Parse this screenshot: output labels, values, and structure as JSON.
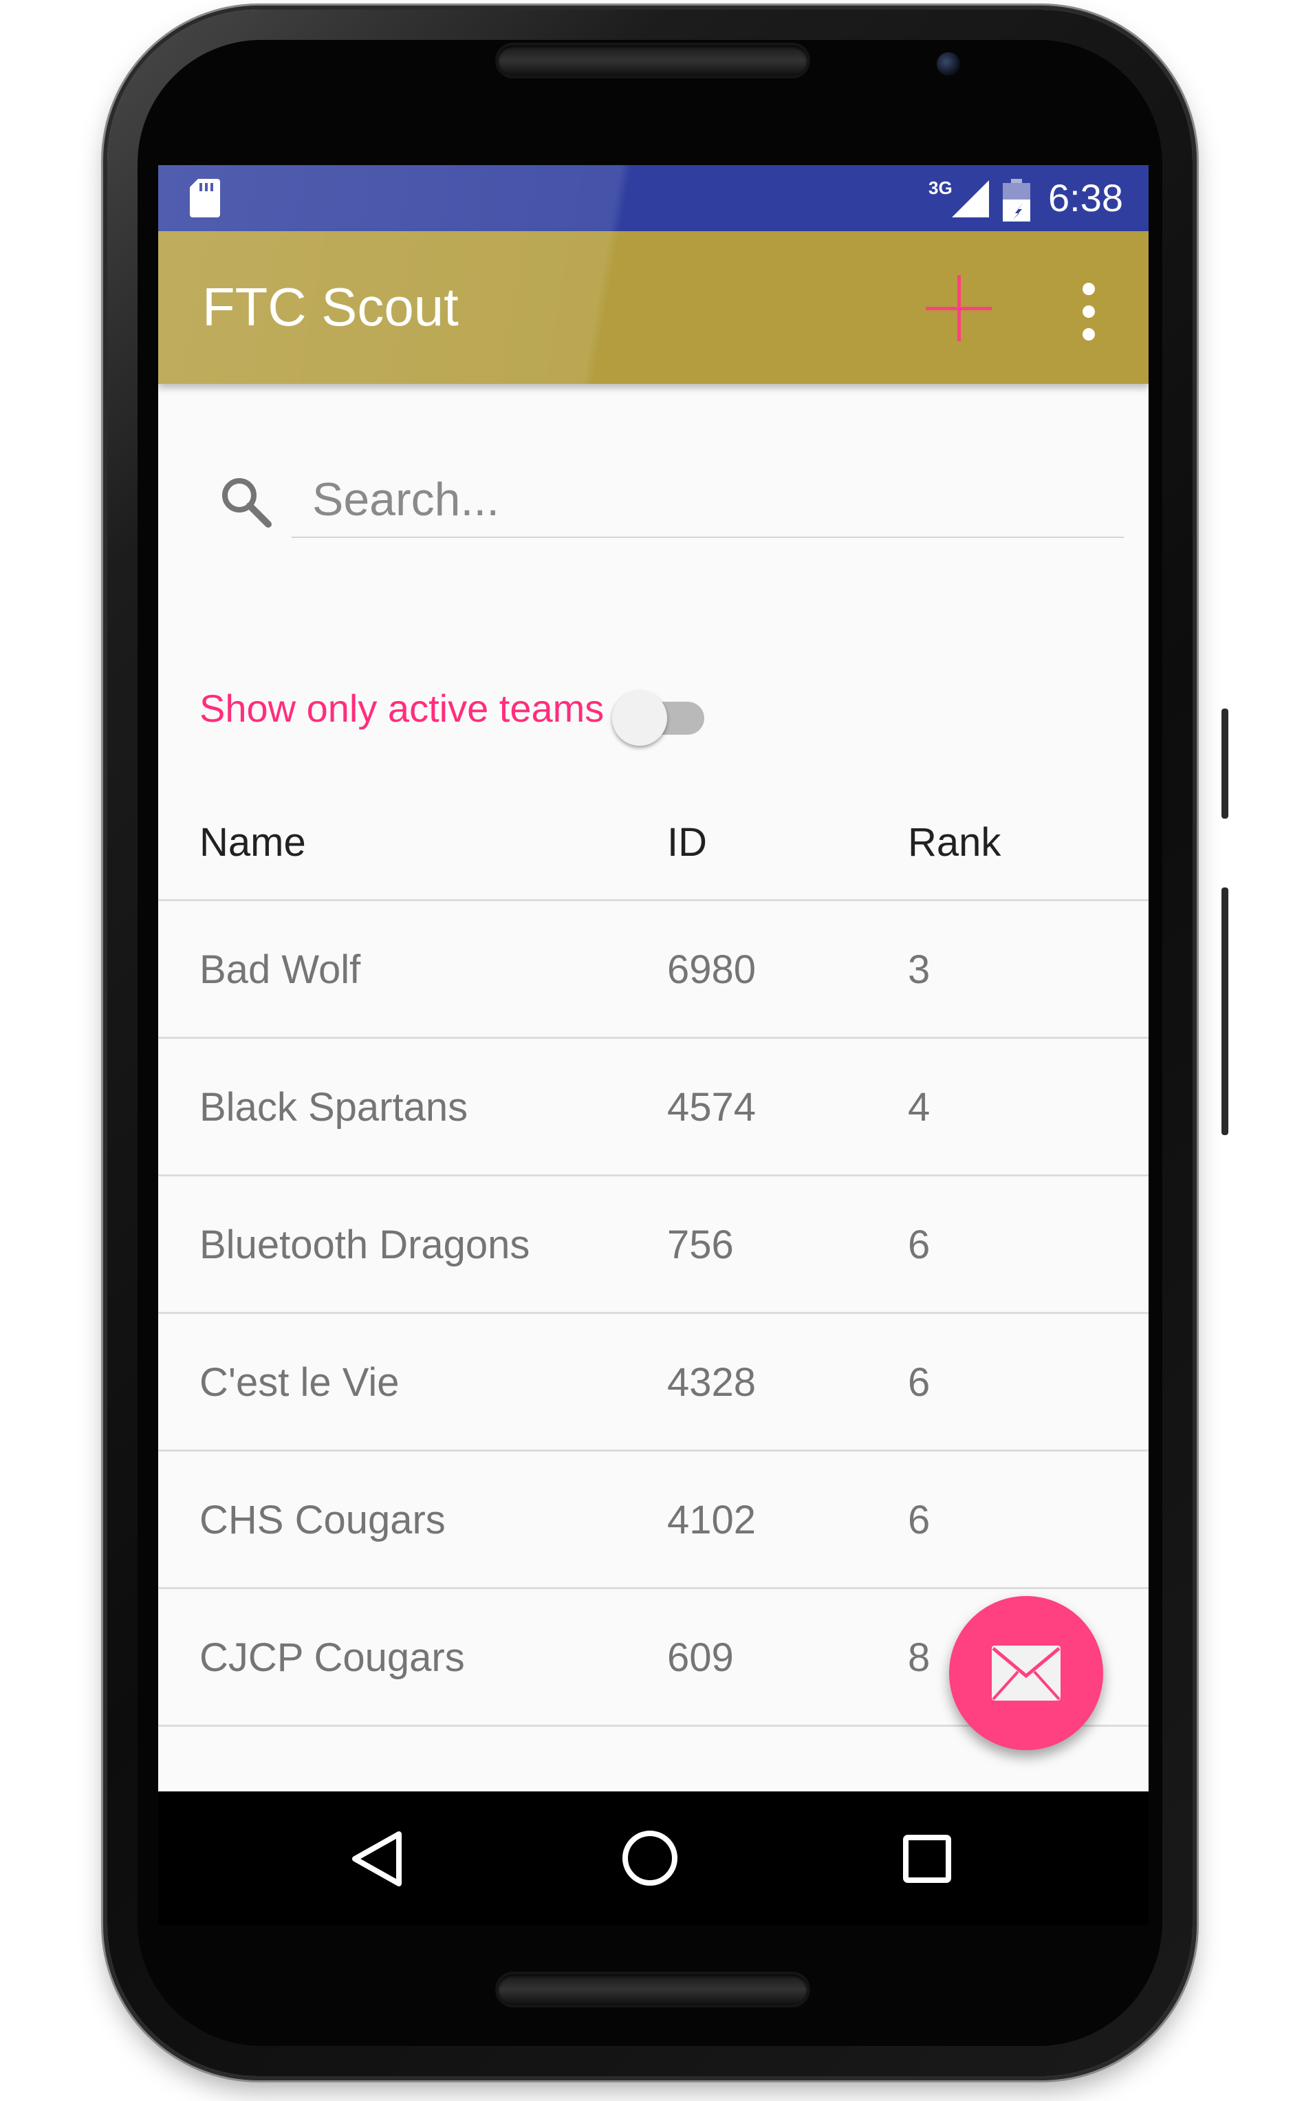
{
  "status_bar": {
    "time": "6:38",
    "network": "3G",
    "icons": [
      "sd-card-icon",
      "signal-icon",
      "battery-icon"
    ]
  },
  "toolbar": {
    "title": "FTC Scout",
    "add_icon": "plus-icon",
    "menu_icon": "overflow-menu-icon",
    "background": "#b39d3f",
    "add_color": "#ff4081"
  },
  "search": {
    "placeholder": "Search...",
    "value": "",
    "icon": "search-icon"
  },
  "filter": {
    "label": "Show only active teams",
    "enabled": false,
    "label_color": "#ff2d7c"
  },
  "table": {
    "headers": {
      "name": "Name",
      "id": "ID",
      "rank": "Rank"
    },
    "rows": [
      {
        "name": "Bad Wolf",
        "id": "6980",
        "rank": "3"
      },
      {
        "name": "Black Spartans",
        "id": "4574",
        "rank": "4"
      },
      {
        "name": "Bluetooth Dragons",
        "id": "756",
        "rank": "6"
      },
      {
        "name": "C'est le Vie",
        "id": "4328",
        "rank": "6"
      },
      {
        "name": "CHS Cougars",
        "id": "4102",
        "rank": "6"
      },
      {
        "name": "CJCP Cougars",
        "id": "609",
        "rank": "8"
      }
    ]
  },
  "fab": {
    "icon": "mail-icon",
    "color": "#ff4081"
  },
  "navigation_bar": {
    "buttons": [
      "back-icon",
      "home-icon",
      "recents-icon"
    ]
  }
}
